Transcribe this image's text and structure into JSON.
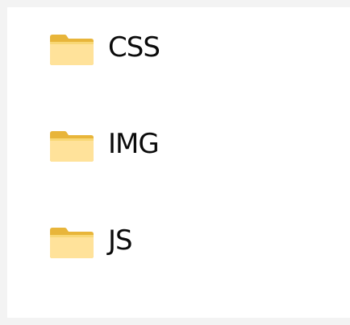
{
  "folders": [
    {
      "label": "CSS",
      "icon": "folder-icon"
    },
    {
      "label": "IMG",
      "icon": "folder-icon"
    },
    {
      "label": "JS",
      "icon": "folder-icon"
    }
  ],
  "colors": {
    "folder_body": "#f8d775",
    "folder_tab": "#e8b53a",
    "folder_front": "#ffe9a0",
    "text": "#0b0b0b",
    "background": "#ffffff",
    "frame": "#f3f3f3"
  }
}
